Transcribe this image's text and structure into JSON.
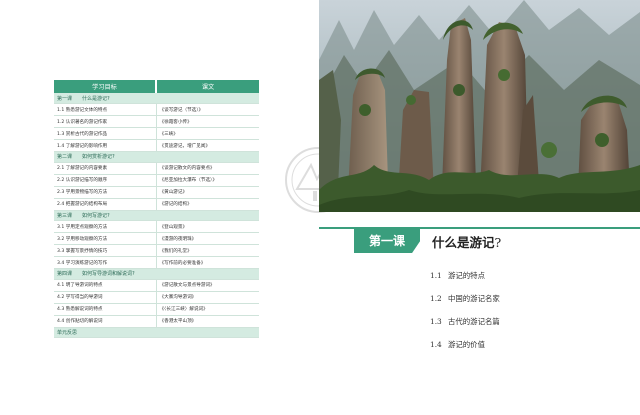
{
  "table": {
    "headers": [
      "学习目标",
      "课文"
    ],
    "units": [
      {
        "num": "第一课",
        "title": "什么是游记?",
        "rows": [
          [
            "1.1 熟悉游记文体的特点",
            "《谈写游记（节选）》"
          ],
          [
            "1.2 认识著名的游记作家",
            "《徐霞客小传》"
          ],
          [
            "1.3 赏析古代的游记作品",
            "《三峡》"
          ],
          [
            "1.4 了解游记的影响作用",
            "《贯途游记，增广见闻》"
          ]
        ]
      },
      {
        "num": "第二课",
        "title": "如何赏析游记?",
        "rows": [
          [
            "2.1 了解游记的内容要素",
            "《谈游记散文的内容要点》"
          ],
          [
            "2.2 认识游记描写的顺序",
            "《尼亚加拉大瀑布（节选）》"
          ],
          [
            "2.3 学用景物描写的方法",
            "《黄山游记》"
          ],
          [
            "2.4 把握游记的结构布局",
            "《游记的结构》"
          ]
        ]
      },
      {
        "num": "第三课",
        "title": "如何写游记?",
        "rows": [
          [
            "3.1 学用定点观察的方法",
            "《登山观景》"
          ],
          [
            "3.2 学用移动观察的方法",
            "《漫游的夜明珠》"
          ],
          [
            "3.3 掌握写景抒情的技巧",
            "《我们的礼堂》"
          ],
          [
            "3.4 学习演练游记的写作",
            "《写作前的必要准备》"
          ]
        ]
      },
      {
        "num": "第四课",
        "title": "如何写导游词和解说词?",
        "rows": [
          [
            "4.1 明了导游词的特点",
            "《游记散文与景点导游词》"
          ],
          [
            "4.2 学写得当的导游词",
            "《大寨沟导游词》"
          ],
          [
            "4.3 熟悉解说词的特点",
            "《〈长江三峡〉解说词》"
          ],
          [
            "4.4 创作贴切的解说词",
            "《香港太平山顶》"
          ]
        ]
      }
    ],
    "footer": "单元反思"
  },
  "lesson": {
    "tab": "第一课",
    "title": "什么是游记",
    "title_mark": "?",
    "items": [
      {
        "num": "1.1",
        "text": "游记的特点"
      },
      {
        "num": "1.2",
        "text": "中国的游记名家"
      },
      {
        "num": "1.3",
        "text": "古代的游记名篇"
      },
      {
        "num": "1.4",
        "text": "游记的价值"
      }
    ]
  },
  "colors": {
    "accent": "#3a9e7d",
    "unit_row": "#d4ebe1"
  },
  "image": {
    "subject": "sandstone-pillar-landscape"
  }
}
